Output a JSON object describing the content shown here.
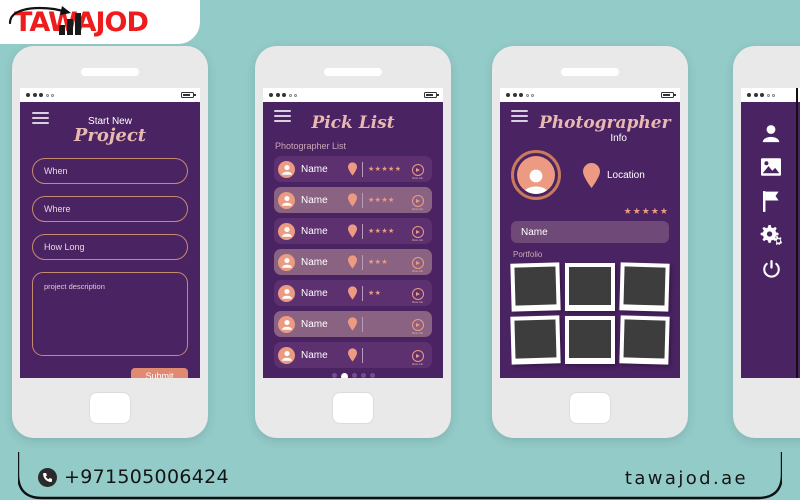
{
  "brand": {
    "logo_text": "TAWAJOD",
    "logo_color": "#ee1c1c",
    "bar_color": "#1a1a1a"
  },
  "theme": {
    "background": "#93cbc9",
    "screen_purple": "#4a2362",
    "accent_salmon": "#ec9b82",
    "accent_copper": "#c97a5c",
    "phone_body": "#e9e9e9"
  },
  "footer": {
    "phone_number": "+971505006424",
    "website": "tawajod.ae",
    "phone_icon": "phone-icon"
  },
  "phones": [
    {
      "name": "start-new-project",
      "title_small": "Start New",
      "title_script": "Project",
      "menu_icon": "hamburger-icon",
      "fields": [
        {
          "label": "When"
        },
        {
          "label": "Where"
        },
        {
          "label": "How Long"
        }
      ],
      "description_placeholder": "project description",
      "submit_label": "Submit"
    },
    {
      "name": "pick-list",
      "title_script": "Pick List",
      "menu_icon": "hamburger-icon",
      "section_label": "Photographer List",
      "more_info_label": "More info",
      "rows": [
        {
          "name": "Name",
          "stars": 5,
          "highlight": false
        },
        {
          "name": "Name",
          "stars": 4,
          "highlight": true
        },
        {
          "name": "Name",
          "stars": 4,
          "highlight": false
        },
        {
          "name": "Name",
          "stars": 3,
          "highlight": true
        },
        {
          "name": "Name",
          "stars": 2,
          "highlight": false
        },
        {
          "name": "Name",
          "stars": 0,
          "highlight": true
        },
        {
          "name": "Name",
          "stars": 0,
          "highlight": false
        }
      ],
      "pagination": {
        "count": 5,
        "active_index": 1
      }
    },
    {
      "name": "photographer-info",
      "title_script": "Photographer",
      "title_small": "Info",
      "menu_icon": "hamburger-icon",
      "location_label": "Location",
      "location_icon": "map-pin-icon",
      "rating_stars": 5,
      "name_value": "Name",
      "portfolio_label": "Portfolio",
      "portfolio_count": 6
    },
    {
      "name": "side-menu",
      "items": [
        {
          "icon": "person-icon",
          "label": "Profile"
        },
        {
          "icon": "photo-icon",
          "label": "Portfolio"
        },
        {
          "icon": "flag-icon",
          "label": "Notifications"
        },
        {
          "icon": "gears-icon",
          "label": "Settings"
        },
        {
          "icon": "power-icon",
          "label": "Logout"
        }
      ]
    }
  ],
  "status_bar": {
    "signal_on": 3,
    "signal_off": 2
  }
}
